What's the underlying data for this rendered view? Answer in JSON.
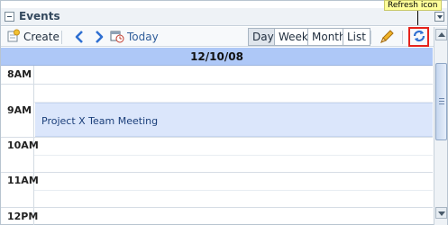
{
  "header": {
    "title": "Events"
  },
  "callout": {
    "text": "Refresh icon"
  },
  "toolbar": {
    "create_label": "Create",
    "today_label": "Today",
    "views": [
      "Day",
      "Week",
      "Month",
      "List"
    ],
    "selected_view": "Day"
  },
  "date_bar": {
    "date": "12/10/08"
  },
  "hours": [
    "8AM",
    "9AM",
    "10AM",
    "11AM",
    "12PM"
  ],
  "event": {
    "title": "Project X Team Meeting"
  },
  "colors": {
    "date_bar": "#aec8f7",
    "event_bg": "#dbe6fb",
    "callout_bg": "#ffff99",
    "highlight_border": "#e5231b"
  },
  "icons": [
    "collapse-icon",
    "menu-dropdown-icon",
    "create-icon",
    "prev-arrow-icon",
    "next-arrow-icon",
    "calendar-today-icon",
    "edit-pencil-icon",
    "refresh-icon"
  ]
}
